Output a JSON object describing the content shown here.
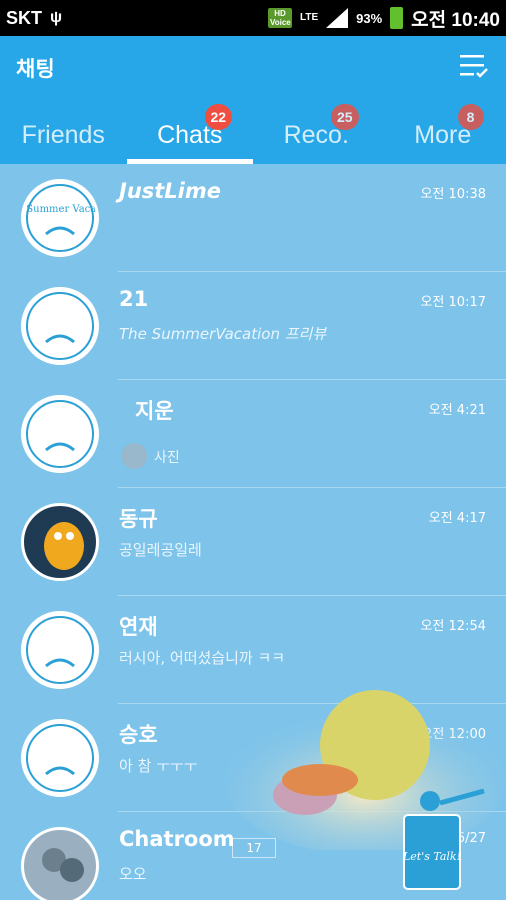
{
  "status_bar": {
    "carrier": "SKT",
    "network_label": "LTE",
    "hd_label": "HD Voice",
    "battery": "93%",
    "time": "오전 10:40"
  },
  "header": {
    "title": "채팅"
  },
  "tabs": [
    {
      "label": "Friends",
      "badge": ""
    },
    {
      "label": "Chats",
      "badge": "22"
    },
    {
      "label": "Reco.",
      "badge": "25"
    },
    {
      "label": "More",
      "badge": "8"
    }
  ],
  "chats": [
    {
      "name": "JustLime",
      "preview": "",
      "time": "오전 10:38"
    },
    {
      "name": "21",
      "preview": "The SummerVacation 프리뷰",
      "time": "오전 10:17"
    },
    {
      "name": "지운",
      "preview": "사진",
      "time": "오전 4:21"
    },
    {
      "name": "동규",
      "preview": "공일레공일레",
      "time": "오전 4:17"
    },
    {
      "name": "연재",
      "preview": "러시아, 어떠셨습니까 ㅋㅋ",
      "time": "오전 12:54"
    },
    {
      "name": "승호",
      "preview": "아 참 ㅜㅜㅜ",
      "time": "오전 12:00"
    },
    {
      "name": "Chatroom",
      "preview": "오오",
      "time": "6/27",
      "members": "17"
    }
  ],
  "avatar_text": "The Summer Vacation",
  "colors": {
    "header": "#27a7e7",
    "list_bg": "#7dc3ea",
    "badge": "#f04e40"
  },
  "decor": {
    "talk_text": "Let's Talk!"
  }
}
